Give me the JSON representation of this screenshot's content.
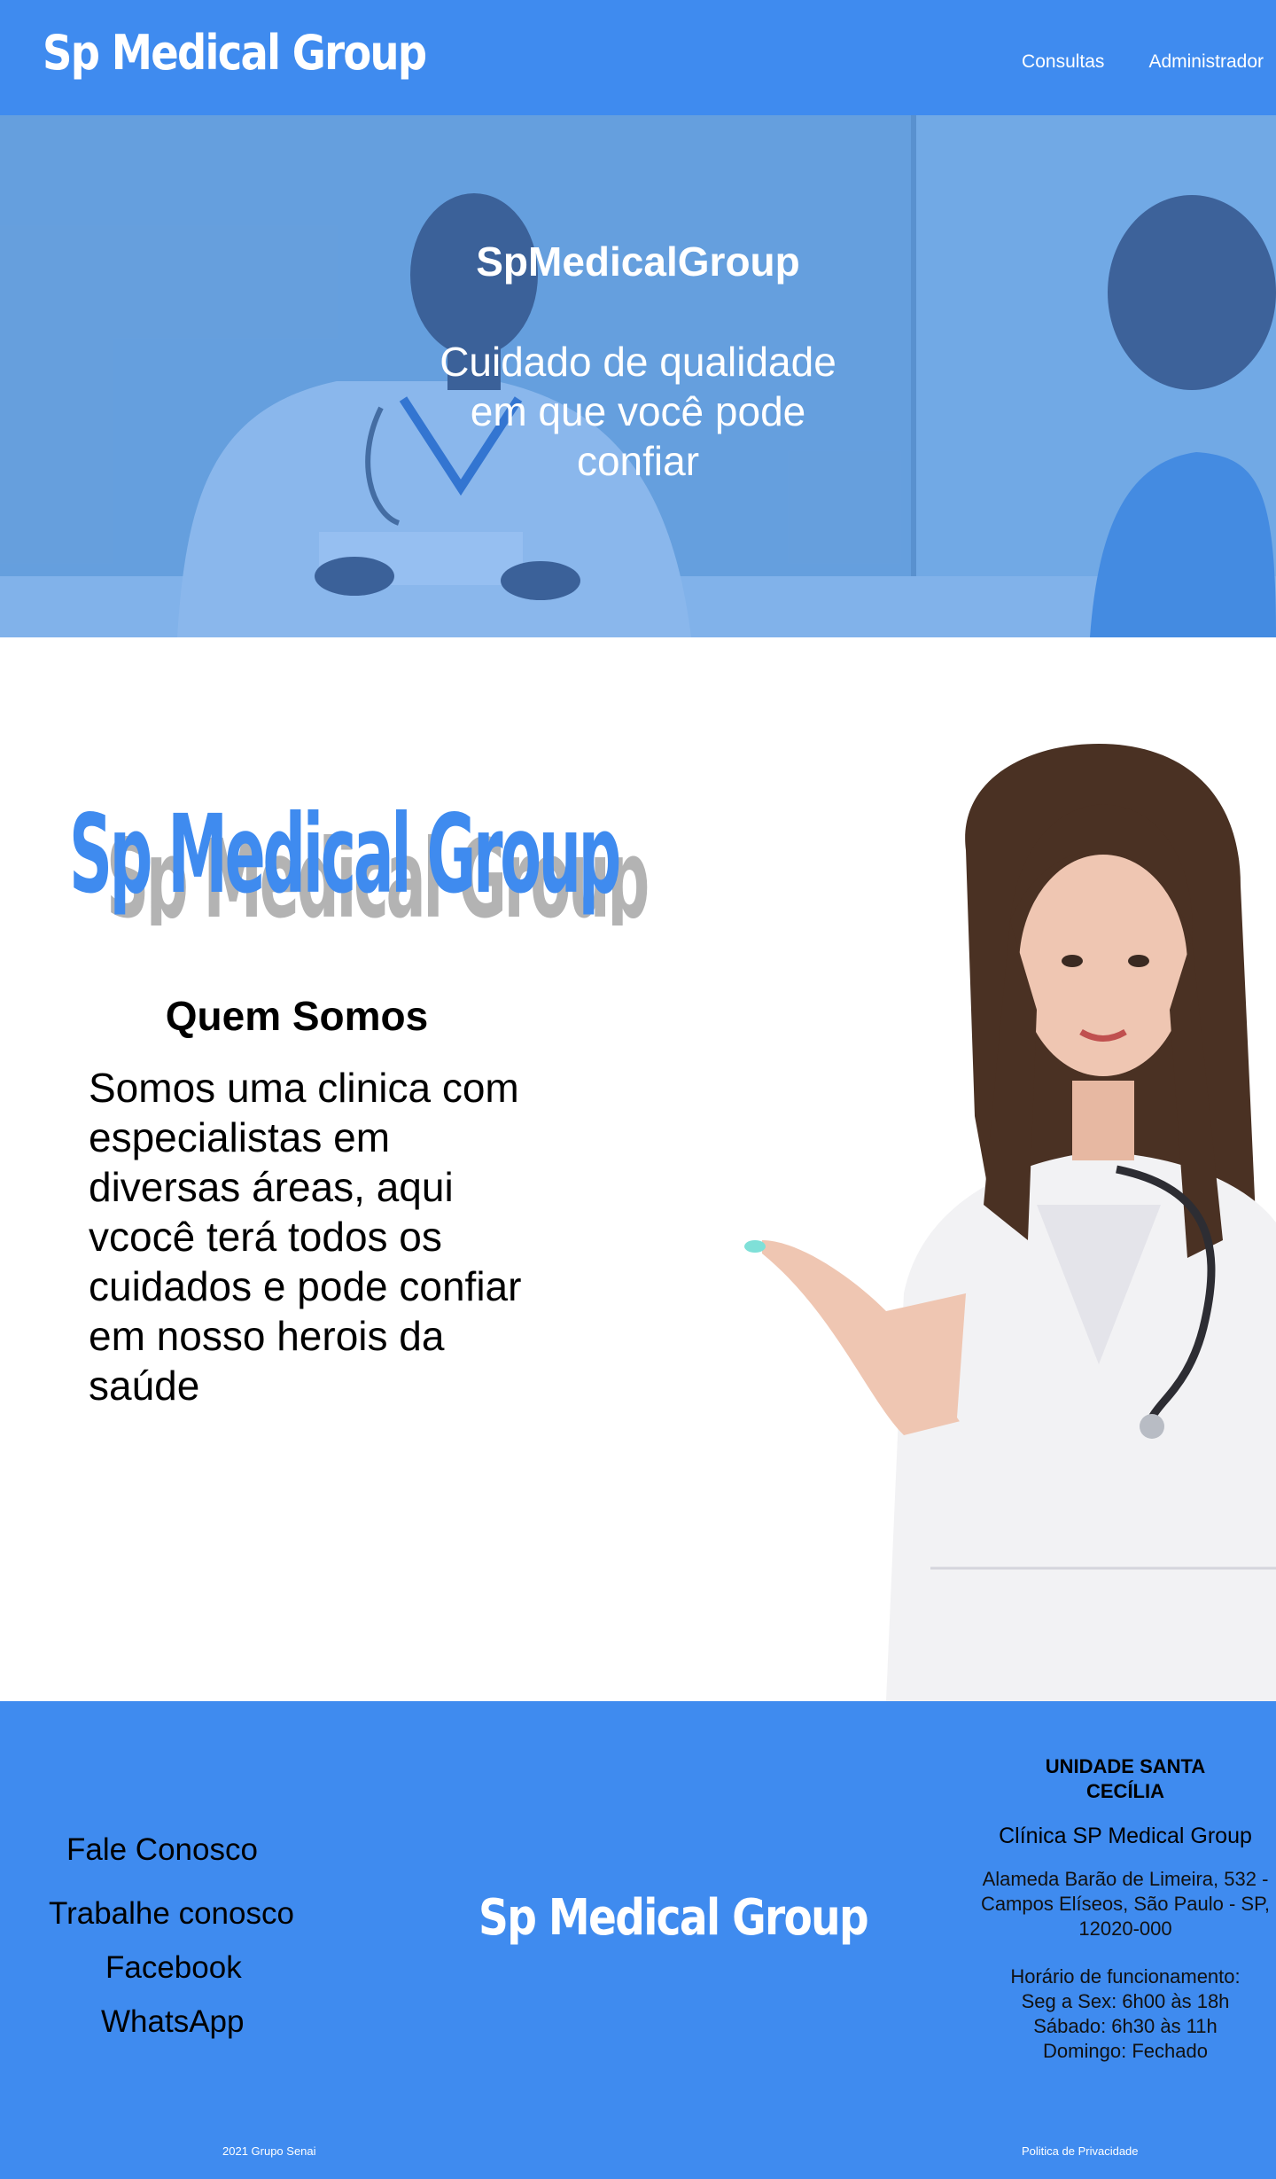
{
  "header": {
    "brand": "Sp Medical Group",
    "nav": [
      "Consultas",
      "Administrador"
    ]
  },
  "hero": {
    "title": "SpMedicalGroup",
    "tagline_lines": [
      "Cuidado de qualidade",
      "em que você pode",
      "confiar"
    ]
  },
  "about": {
    "logo_text": "Sp Medical Group",
    "heading": "Quem Somos",
    "text_lines": [
      "Somos uma clinica com",
      "especialistas em",
      "diversas áreas, aqui",
      "vcocê terá todos os",
      "cuidados e pode confiar",
      "em nosso herois da",
      "saúde"
    ]
  },
  "footer": {
    "links": [
      "Fale Conosco",
      "Trabalhe conosco",
      "Facebook",
      "WhatsApp"
    ],
    "brand": "Sp Medical Group",
    "unit": {
      "title": "UNIDADE SANTA CECÍLIA",
      "clinic": "Clínica SP Medical Group",
      "address_lines": [
        "Alameda Barão de Limeira, 532 -",
        "Campos Elíseos, São Paulo - SP,",
        "12020-000"
      ],
      "hours_lines": [
        "Horário de funcionamento:",
        "Seg a Sex: 6h00 às 18h",
        "Sábado: 6h30 às 11h",
        "Domingo: Fechado"
      ]
    },
    "copyright": "2021 Grupo Senai",
    "privacy": "Politica de Privacidade"
  },
  "colors": {
    "brand_blue": "#3f8bef",
    "white": "#ffffff",
    "text": "#000000"
  }
}
